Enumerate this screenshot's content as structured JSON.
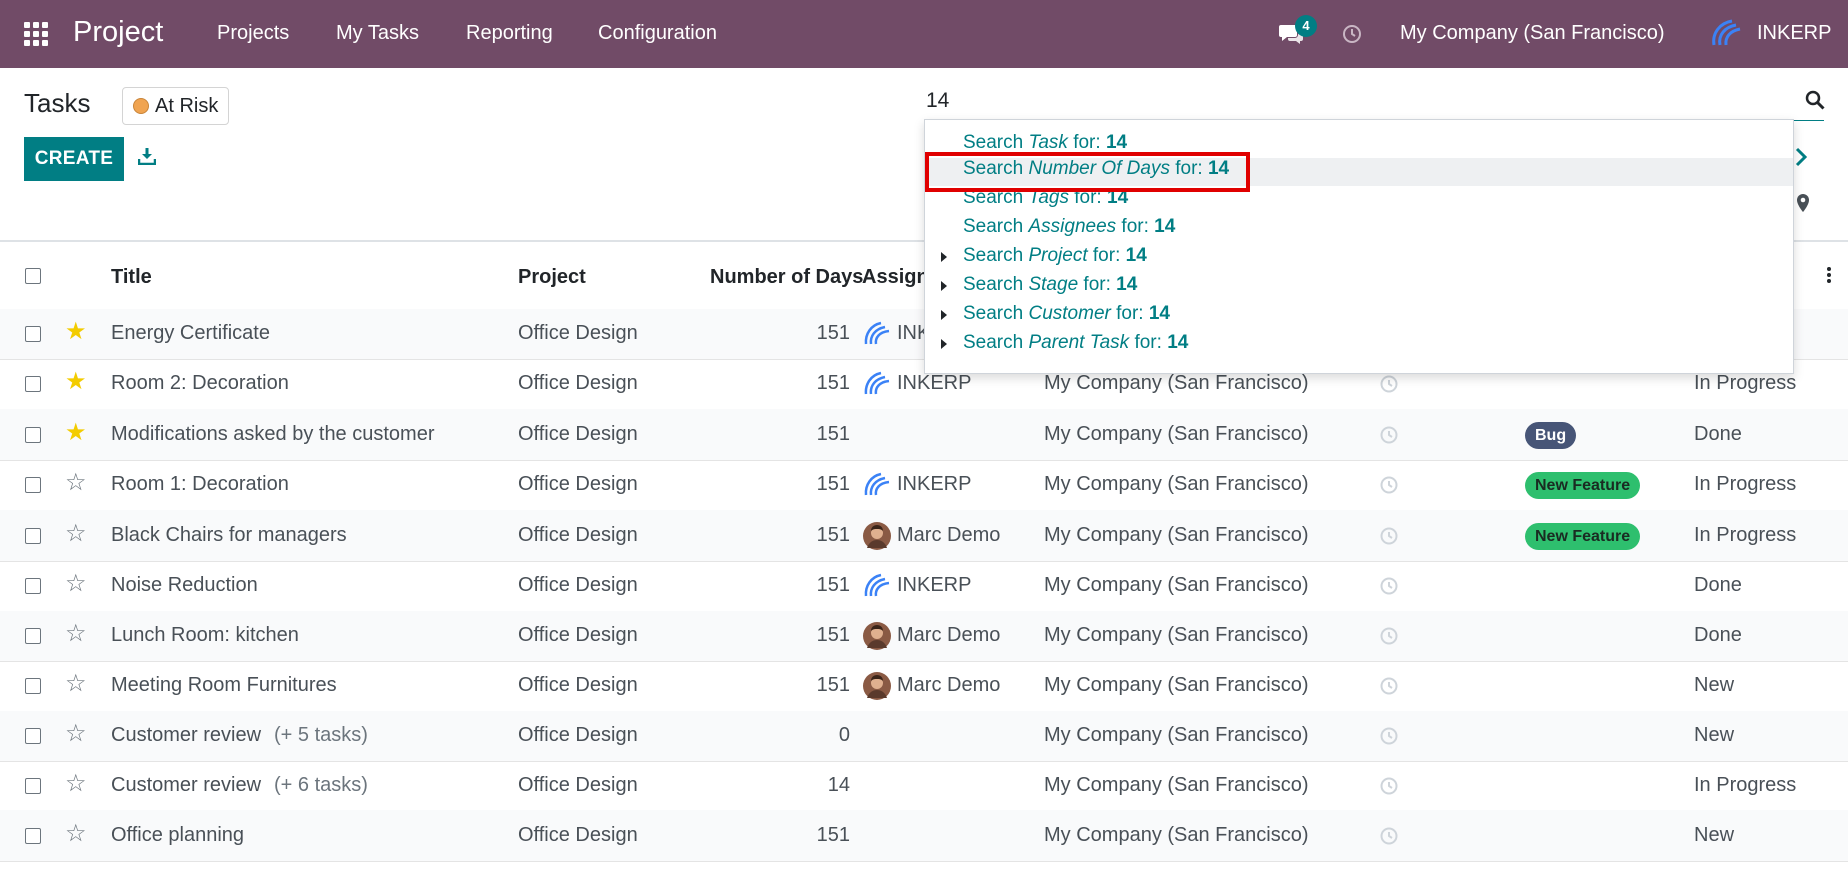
{
  "navbar": {
    "brand": "Project",
    "menu": [
      "Projects",
      "My Tasks",
      "Reporting",
      "Configuration"
    ],
    "chat_count": "4",
    "company": "My Company (San Francisco)",
    "user": "INKERP"
  },
  "control": {
    "title": "Tasks",
    "filter_badge": "At Risk",
    "create_label": "CREATE",
    "search_value": "14"
  },
  "dropdown": [
    {
      "prefix": "Search ",
      "field": "Task",
      "suffix": " for: ",
      "value": "14",
      "expandable": false
    },
    {
      "prefix": "Search ",
      "field": "Number Of Days",
      "suffix": " for: ",
      "value": "14",
      "expandable": false
    },
    {
      "prefix": "Search ",
      "field": "Tags",
      "suffix": " for: ",
      "value": "14",
      "expandable": false
    },
    {
      "prefix": "Search ",
      "field": "Assignees",
      "suffix": " for: ",
      "value": "14",
      "expandable": false
    },
    {
      "prefix": "Search ",
      "field": "Project",
      "suffix": " for: ",
      "value": "14",
      "expandable": true
    },
    {
      "prefix": "Search ",
      "field": "Stage",
      "suffix": " for: ",
      "value": "14",
      "expandable": true
    },
    {
      "prefix": "Search ",
      "field": "Customer",
      "suffix": " for: ",
      "value": "14",
      "expandable": true
    },
    {
      "prefix": "Search ",
      "field": "Parent Task",
      "suffix": " for: ",
      "value": "14",
      "expandable": true
    }
  ],
  "table": {
    "headers": {
      "title": "Title",
      "project": "Project",
      "days": "Number of Days",
      "assignees": "Assigne"
    },
    "rows": [
      {
        "starred": true,
        "title": "Energy Certificate",
        "subtasks": "",
        "project": "Office Design",
        "days": "151",
        "assignee": "INKERP",
        "avatar": "inkerp",
        "company": "",
        "tag": "",
        "tag_kind": "",
        "stage": ""
      },
      {
        "starred": true,
        "title": "Room 2: Decoration",
        "subtasks": "",
        "project": "Office Design",
        "days": "151",
        "assignee": "INKERP",
        "avatar": "inkerp",
        "company": "My Company (San Francisco)",
        "tag": "",
        "tag_kind": "",
        "stage": "In Progress"
      },
      {
        "starred": true,
        "title": "Modifications asked by the customer",
        "subtasks": "",
        "project": "Office Design",
        "days": "151",
        "assignee": "",
        "avatar": "",
        "company": "My Company (San Francisco)",
        "tag": "Bug",
        "tag_kind": "bug",
        "stage": "Done"
      },
      {
        "starred": false,
        "title": "Room 1: Decoration",
        "subtasks": "",
        "project": "Office Design",
        "days": "151",
        "assignee": "INKERP",
        "avatar": "inkerp",
        "company": "My Company (San Francisco)",
        "tag": "New Feature",
        "tag_kind": "feat",
        "stage": "In Progress"
      },
      {
        "starred": false,
        "title": "Black Chairs for managers",
        "subtasks": "",
        "project": "Office Design",
        "days": "151",
        "assignee": "Marc Demo",
        "avatar": "marc",
        "company": "My Company (San Francisco)",
        "tag": "New Feature",
        "tag_kind": "feat",
        "stage": "In Progress"
      },
      {
        "starred": false,
        "title": "Noise Reduction",
        "subtasks": "",
        "project": "Office Design",
        "days": "151",
        "assignee": "INKERP",
        "avatar": "inkerp",
        "company": "My Company (San Francisco)",
        "tag": "",
        "tag_kind": "",
        "stage": "Done"
      },
      {
        "starred": false,
        "title": "Lunch Room: kitchen",
        "subtasks": "",
        "project": "Office Design",
        "days": "151",
        "assignee": "Marc Demo",
        "avatar": "marc",
        "company": "My Company (San Francisco)",
        "tag": "",
        "tag_kind": "",
        "stage": "Done"
      },
      {
        "starred": false,
        "title": "Meeting Room Furnitures",
        "subtasks": "",
        "project": "Office Design",
        "days": "151",
        "assignee": "Marc Demo",
        "avatar": "marc",
        "company": "My Company (San Francisco)",
        "tag": "",
        "tag_kind": "",
        "stage": "New"
      },
      {
        "starred": false,
        "title": "Customer review",
        "subtasks": "(+ 5 tasks)",
        "project": "Office Design",
        "days": "0",
        "assignee": "",
        "avatar": "",
        "company": "My Company (San Francisco)",
        "tag": "",
        "tag_kind": "",
        "stage": "New"
      },
      {
        "starred": false,
        "title": "Customer review",
        "subtasks": "(+ 6 tasks)",
        "project": "Office Design",
        "days": "14",
        "assignee": "",
        "avatar": "",
        "company": "My Company (San Francisco)",
        "tag": "",
        "tag_kind": "",
        "stage": "In Progress"
      },
      {
        "starred": false,
        "title": "Office planning",
        "subtasks": "",
        "project": "Office Design",
        "days": "151",
        "assignee": "",
        "avatar": "",
        "company": "My Company (San Francisco)",
        "tag": "",
        "tag_kind": "",
        "stage": "New"
      }
    ]
  },
  "colors": {
    "navbar": "#714b67",
    "primary": "#017e84",
    "highlight_box": "#e00000",
    "star": "#f3cc00",
    "bug_tag": "#475577",
    "feature_tag": "#2ebf6e"
  }
}
